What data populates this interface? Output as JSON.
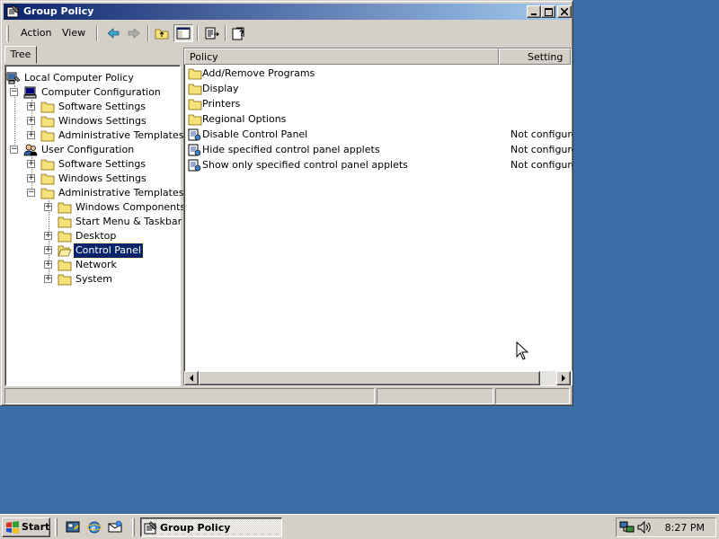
{
  "window": {
    "title": "Group Policy"
  },
  "menu": {
    "items": [
      {
        "label": "Action"
      },
      {
        "label": "View"
      }
    ]
  },
  "toolbar": {
    "buttons": [
      "back-icon",
      "forward-icon",
      "up-folder-icon",
      "show-hide-tree-icon",
      "export-list-icon",
      "help-icon"
    ]
  },
  "tree": {
    "tab_label": "Tree",
    "items": [
      {
        "label": "Local Computer Policy",
        "icon": "policy-computer-icon"
      },
      {
        "label": "Computer Configuration",
        "icon": "computer-icon"
      },
      {
        "label": "Software Settings",
        "icon": "folder-icon"
      },
      {
        "label": "Windows Settings",
        "icon": "folder-icon"
      },
      {
        "label": "Administrative Templates",
        "icon": "folder-icon"
      },
      {
        "label": "User Configuration",
        "icon": "users-icon"
      },
      {
        "label": "Software Settings",
        "icon": "folder-icon"
      },
      {
        "label": "Windows Settings",
        "icon": "folder-icon"
      },
      {
        "label": "Administrative Templates",
        "icon": "folder-icon"
      },
      {
        "label": "Windows Components",
        "icon": "folder-icon"
      },
      {
        "label": "Start Menu & Taskbar",
        "icon": "folder-icon"
      },
      {
        "label": "Desktop",
        "icon": "folder-icon"
      },
      {
        "label": "Control Panel",
        "icon": "open-folder-icon",
        "selected": true
      },
      {
        "label": "Network",
        "icon": "folder-icon"
      },
      {
        "label": "System",
        "icon": "folder-icon"
      }
    ]
  },
  "list": {
    "columns": [
      "Policy",
      "Setting"
    ],
    "rows": [
      {
        "name": "Add/Remove Programs",
        "setting": "",
        "icon": "folder-icon"
      },
      {
        "name": "Display",
        "setting": "",
        "icon": "folder-icon"
      },
      {
        "name": "Printers",
        "setting": "",
        "icon": "folder-icon"
      },
      {
        "name": "Regional Options",
        "setting": "",
        "icon": "folder-icon"
      },
      {
        "name": "Disable Control Panel",
        "setting": "Not configured",
        "icon": "policy-setting-icon"
      },
      {
        "name": "Hide specified control panel applets",
        "setting": "Not configured",
        "icon": "policy-setting-icon"
      },
      {
        "name": "Show only specified control panel applets",
        "setting": "Not configured",
        "icon": "policy-setting-icon"
      }
    ]
  },
  "taskbar": {
    "start_label": "Start",
    "task_label": "Group Policy",
    "clock": "8:27 PM"
  },
  "colors": {
    "desktop": "#3a6ea5",
    "titlebar_start": "#0a246a",
    "titlebar_end": "#a6caf0",
    "face": "#d4d0c8",
    "selection": "#0a246a"
  }
}
